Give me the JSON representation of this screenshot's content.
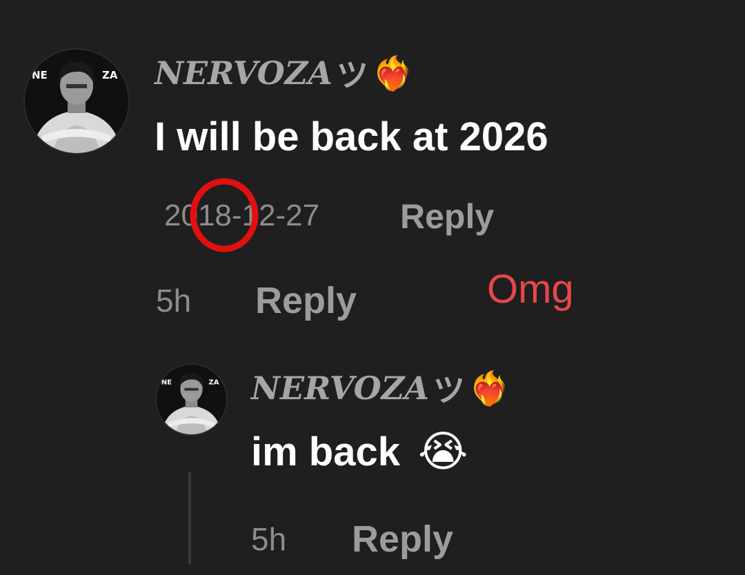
{
  "comment": {
    "username": "NERVOZA",
    "username_symbol": "ツ",
    "username_emoji": "❤️‍🔥",
    "avatar_text_left": "NE",
    "avatar_text_right": "ZA",
    "text": "I will be back at 2026",
    "date": "2018-12-27",
    "reply_label": "Reply"
  },
  "overlay": {
    "time": "5h",
    "reply_label": "Reply",
    "annotation": "Omg",
    "annotation_color": "#e8474b",
    "circle_color": "#e01010"
  },
  "reply": {
    "username": "NERVOZA",
    "username_symbol": "ツ",
    "username_emoji": "❤️‍🔥",
    "avatar_text_left": "NE",
    "avatar_text_right": "ZA",
    "text": "im back",
    "emoji": "😭",
    "time": "5h",
    "reply_label": "Reply"
  },
  "theme": {
    "background": "#1f1f1f",
    "username_color": "#a6a6a6",
    "meta_color": "#8d8d8d"
  }
}
